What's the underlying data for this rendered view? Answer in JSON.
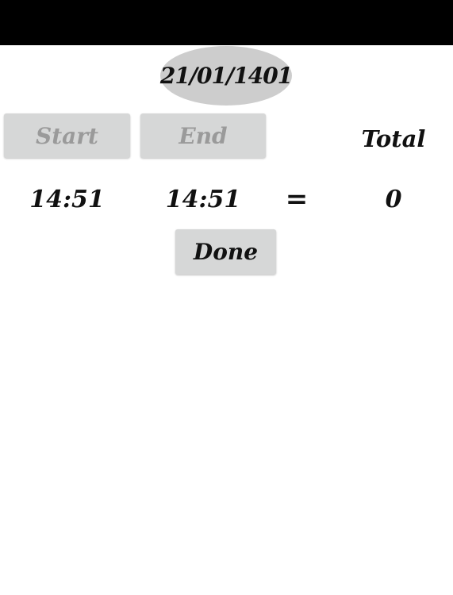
{
  "date": "21/01/1401",
  "buttons": {
    "start": "Start",
    "end": "End",
    "done": "Done"
  },
  "total_label": "Total",
  "start_time": "14:51",
  "end_time": "14:51",
  "equals": "=",
  "total_value": "0",
  "colors": {
    "status_bar": "#000000",
    "button_bg": "#d6d7d7",
    "disabled_text": "#9a9a9a",
    "date_pill": "#cdcdcd"
  }
}
